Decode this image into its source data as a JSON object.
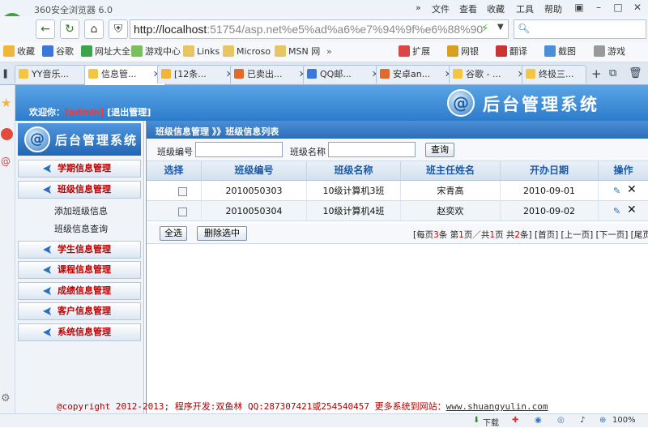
{
  "browser": {
    "title": "360安全浏览器 6.0",
    "menu": [
      "文件",
      "查看",
      "收藏",
      "工具",
      "帮助"
    ],
    "url": {
      "host": "http://localhost",
      "rest": ":51754/asp.net%e5%ad%a6%e7%94%9f%e6%88%90"
    },
    "favorites": [
      "收藏",
      "谷歌",
      "网址大全",
      "游戏中心",
      "Links",
      "Microso",
      "MSN 网"
    ],
    "toolbar_right": [
      "扩展",
      "网银",
      "翻译",
      "截图",
      "游戏"
    ],
    "tabs": [
      "YY音乐...",
      "信息管...",
      "[12条...",
      "已卖出...",
      "QQ邮...",
      "安卓an...",
      "谷歌 - ...",
      "终极三..."
    ],
    "status": {
      "download": "下载",
      "zoom": "100%"
    }
  },
  "header": {
    "welcome_prefix": "欢迎你：",
    "user": "[admin]",
    "logout": "[退出管理]",
    "brand": "后台管理系统"
  },
  "sidebar": {
    "title": "后台管理系统",
    "items": [
      {
        "label": "学期信息管理"
      },
      {
        "label": "班级信息管理"
      },
      {
        "label": "学生信息管理"
      },
      {
        "label": "课程信息管理"
      },
      {
        "label": "成绩信息管理"
      },
      {
        "label": "客户信息管理"
      },
      {
        "label": "系统信息管理"
      }
    ],
    "subitems": [
      "添加班级信息",
      "班级信息查询"
    ]
  },
  "main": {
    "breadcrumb": "班级信息管理 》》班级信息列表",
    "search": {
      "class_no_label": "班级编号",
      "class_name_label": "班级名称",
      "button": "查询"
    },
    "table": {
      "headers": [
        "选择",
        "班级编号",
        "班级名称",
        "班主任姓名",
        "开办日期",
        "操作"
      ],
      "rows": [
        [
          "2010050303",
          "10级计算机3班",
          "宋青高",
          "2010-09-01"
        ],
        [
          "2010050304",
          "10级计算机4班",
          "赵奕欢",
          "2010-09-02"
        ]
      ]
    },
    "buttons": {
      "select_all": "全选",
      "delete_selected": "删除选中"
    },
    "pager": {
      "p1": "[每页",
      "per_page": "3",
      "p2": "条 第",
      "current": "1",
      "p3": "页／共",
      "total_pages": "1",
      "p4": "页 共",
      "total": "2",
      "p5": "条]",
      "first": "[首页]",
      "prev": "[上一页]",
      "next": "[下一页]",
      "last": "[尾页]"
    }
  },
  "footer": {
    "text": "@copyright 2012-2013; 程序开发:双鱼林  QQ:287307421或254540457  更多系统到网站：",
    "link": "www.shuangyulin.com"
  },
  "colors": {
    "accent": "#2d7ccc",
    "nav_text": "#c00000",
    "header_text": "#1d5aa5"
  }
}
